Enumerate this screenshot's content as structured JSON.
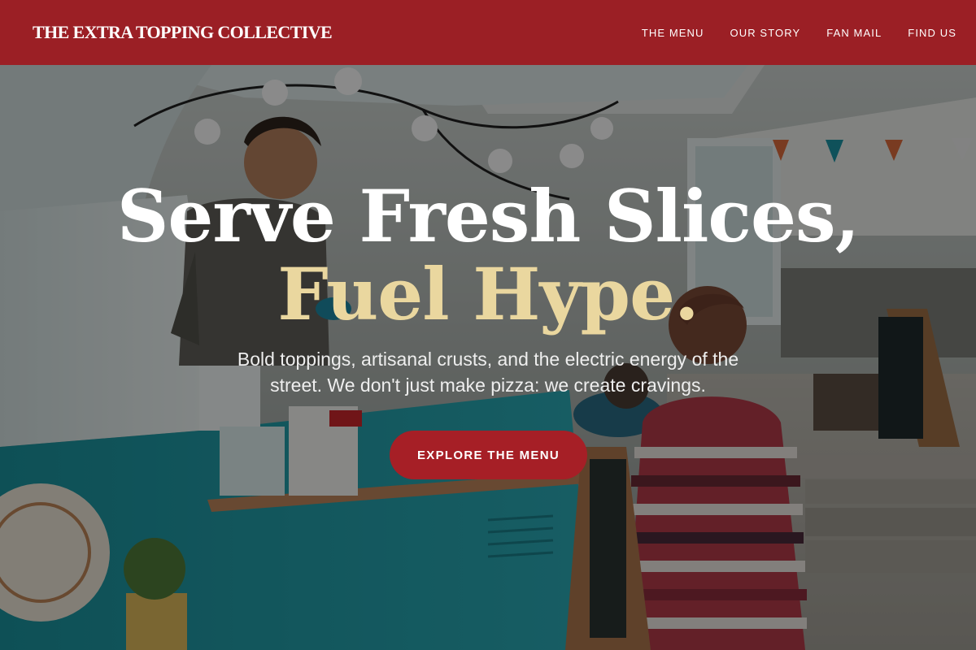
{
  "brand": {
    "name": "THE EXTRA TOPPING COLLECTIVE"
  },
  "nav": [
    {
      "label": "THE MENU"
    },
    {
      "label": "OUR STORY"
    },
    {
      "label": "FAN MAIL"
    },
    {
      "label": "FIND US"
    }
  ],
  "hero": {
    "headline_line1": "Serve Fresh Slices,",
    "headline_line2": "Fuel Hype.",
    "subtitle": "Bold toppings, artisanal crusts, and the electric energy of the street. We don't just make pizza: we create cravings.",
    "cta_label": "EXPLORE THE MENU"
  },
  "colors": {
    "header_bg": "#9b1f25",
    "cta_bg": "#a61f26",
    "headline_accent": "#ead79f",
    "headline_primary": "#ffffff"
  },
  "icons": [
    "string-light-bulb-icon"
  ]
}
